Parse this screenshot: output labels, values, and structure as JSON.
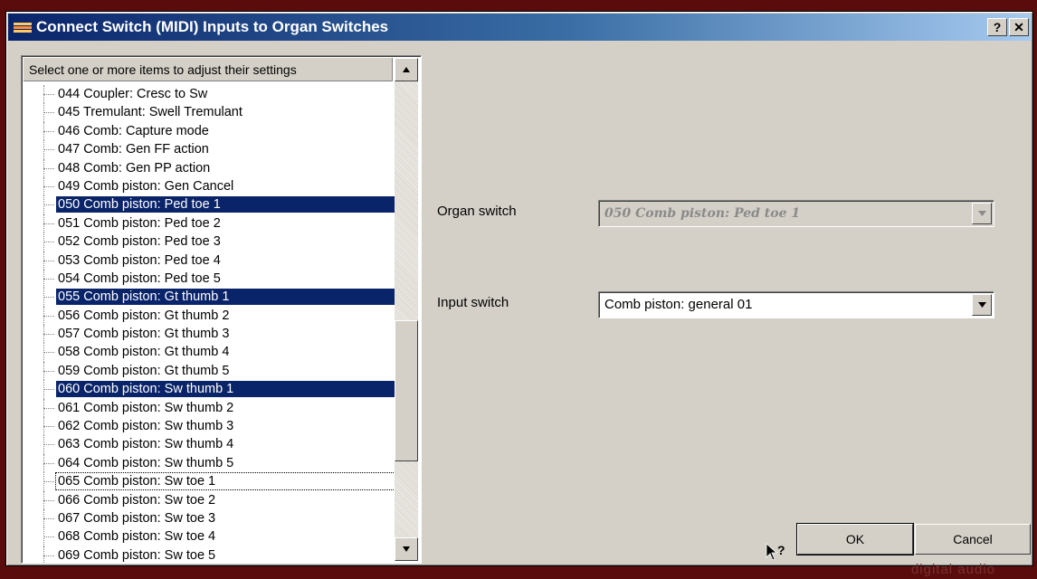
{
  "window": {
    "title": "Connect Switch (MIDI) Inputs to Organ Switches",
    "help_btn": "?",
    "close_btn": "✕"
  },
  "list": {
    "header": "Select one or more items to adjust their settings",
    "items": [
      {
        "label": "044 Coupler: Cresc to Sw",
        "selected": false
      },
      {
        "label": "045 Tremulant: Swell Tremulant",
        "selected": false
      },
      {
        "label": "046 Comb: Capture mode",
        "selected": false
      },
      {
        "label": "047 Comb: Gen FF action",
        "selected": false
      },
      {
        "label": "048 Comb: Gen PP action",
        "selected": false
      },
      {
        "label": "049 Comb piston: Gen Cancel",
        "selected": false
      },
      {
        "label": "050 Comb piston: Ped toe 1",
        "selected": true
      },
      {
        "label": "051 Comb piston: Ped toe 2",
        "selected": false
      },
      {
        "label": "052 Comb piston: Ped toe 3",
        "selected": false
      },
      {
        "label": "053 Comb piston: Ped toe 4",
        "selected": false
      },
      {
        "label": "054 Comb piston: Ped toe 5",
        "selected": false
      },
      {
        "label": "055 Comb piston: Gt thumb 1",
        "selected": true
      },
      {
        "label": "056 Comb piston: Gt thumb 2",
        "selected": false
      },
      {
        "label": "057 Comb piston: Gt thumb 3",
        "selected": false
      },
      {
        "label": "058 Comb piston: Gt thumb 4",
        "selected": false
      },
      {
        "label": "059 Comb piston: Gt thumb 5",
        "selected": false
      },
      {
        "label": "060 Comb piston: Sw thumb 1",
        "selected": true
      },
      {
        "label": "061 Comb piston: Sw thumb 2",
        "selected": false
      },
      {
        "label": "062 Comb piston: Sw thumb 3",
        "selected": false
      },
      {
        "label": "063 Comb piston: Sw thumb 4",
        "selected": false
      },
      {
        "label": "064 Comb piston: Sw thumb 5",
        "selected": false
      },
      {
        "label": "065 Comb piston: Sw toe 1",
        "selected": false,
        "focused": true
      },
      {
        "label": "066 Comb piston: Sw toe 2",
        "selected": false
      },
      {
        "label": "067 Comb piston: Sw toe 3",
        "selected": false
      },
      {
        "label": "068 Comb piston: Sw toe 4",
        "selected": false
      },
      {
        "label": "069 Comb piston: Sw toe 5",
        "selected": false
      }
    ]
  },
  "organ_switch": {
    "label": "Organ switch",
    "value": "050 Comb piston: Ped toe 1",
    "enabled": false
  },
  "input_switch": {
    "label": "Input switch",
    "value": "Comb piston: general 01",
    "enabled": true
  },
  "buttons": {
    "ok": "OK",
    "cancel": "Cancel"
  },
  "icons": {
    "help_cursor": "help-cursor-icon",
    "scroll_up": "scroll-up-icon",
    "scroll_down": "scroll-down-icon",
    "dropdown": "chevron-down-icon"
  },
  "colors": {
    "selection": "#0a246a",
    "title_start": "#0a246a",
    "title_end": "#a6caf0",
    "dialog_bg": "#d4d0c8"
  },
  "watermark": "digital audio"
}
